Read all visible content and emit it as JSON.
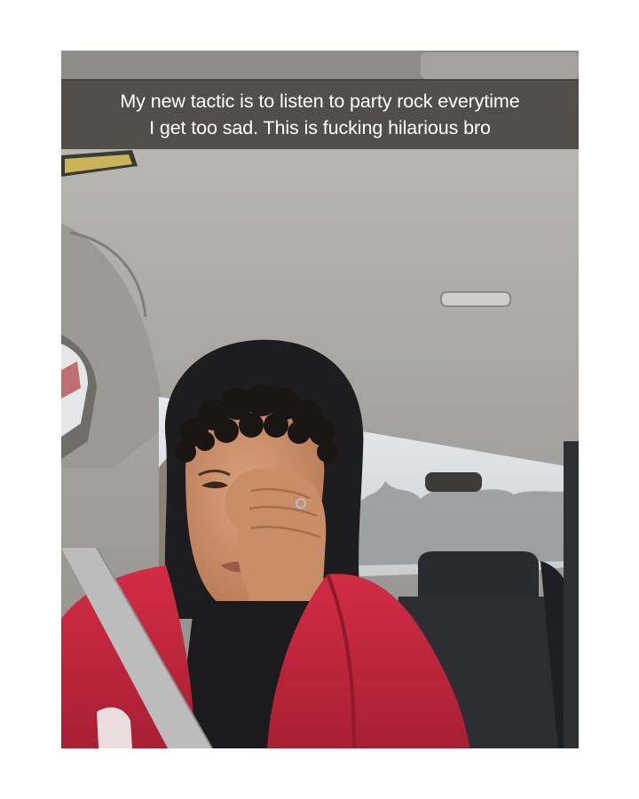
{
  "snap": {
    "caption_lines": [
      "My new tactic is to listen to party rock everytime",
      "I get too sad. This is fucking hilarious bro"
    ]
  },
  "colors": {
    "page_background": "#ffffff",
    "caption_bar": "#34302a",
    "caption_text": "#ffffff",
    "car_headliner": "#a9a8a4",
    "hoodie_red": "#c9283f",
    "hood_black": "#1d1d1f"
  }
}
